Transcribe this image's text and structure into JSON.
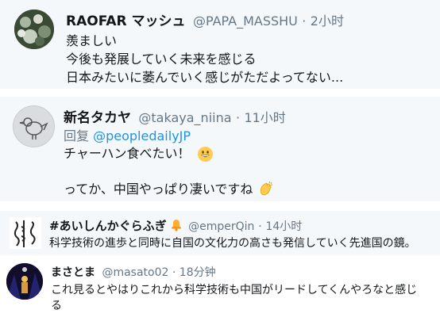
{
  "tweets": [
    {
      "name": "RAOFAR マッシュ",
      "handle": "@PAPA_MASSHU",
      "separator": "·",
      "time": "2小时",
      "lines": [
        "羨ましい",
        "今後も発展していく未来を感じる",
        "日本みたいに萎んでいく感じがただよってない..."
      ]
    },
    {
      "name": "新名タカヤ",
      "handle": "@takaya_niina",
      "separator": "·",
      "time": "11小时",
      "reply_prefix": "回复",
      "reply_to": "@peopledailyJP",
      "lines": [
        "チャーハン食べたい！",
        "ってか、中国やっぱり凄いですね"
      ]
    },
    {
      "name": "#あいしんかぐらふぎ",
      "handle": "@emperQin",
      "separator": "·",
      "time": "14小时",
      "lines": [
        "科学技術の進歩と同時に自国の文化力の高さも発信していく先進国の鏡。"
      ]
    },
    {
      "name": "まさとま",
      "handle": "@masato02",
      "separator": "·",
      "time": "18分钟",
      "lines": [
        "これ見るとやはりこれから科学技術も中国がリードしてくんやろなと感じ",
        "る"
      ]
    }
  ],
  "icons": {
    "grin": "grinning-face-emoji",
    "clap": "clapping-hands-emoji",
    "bell": "bell-emoji"
  }
}
